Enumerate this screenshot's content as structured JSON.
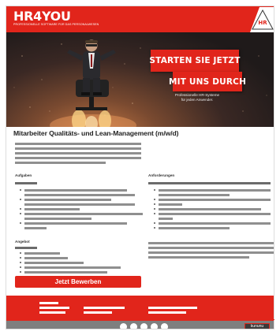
{
  "header": {
    "logo_text": "HR4YOU",
    "logo_subtitle": "PROFESSIONELLE SOFTWARE FÜR DAS PERSONALWESEN",
    "badge_text": "HR"
  },
  "hero": {
    "cta_primary": "STARTEN SIE JETZT",
    "cta_secondary": "MIT UNS DURCH",
    "tagline_line1": "Professionelle HR-Systeme",
    "tagline_line2": "für jeden Anwender."
  },
  "job": {
    "title": "Mitarbeiter Qualitäts- und Lean-Management (m/w/d)"
  },
  "sections": {
    "tasks": "Aufgaben",
    "requirements": "Anforderungen",
    "offer": "Angebot"
  },
  "apply_button": "Jetzt Bewerben",
  "footer": {
    "rating_brand": "kununu",
    "rating_stars": "★★★★★"
  },
  "colors": {
    "brand_red": "#e1251b",
    "footer_grey": "#7f7f7f",
    "placeholder_bar": "#8f8f8f"
  }
}
